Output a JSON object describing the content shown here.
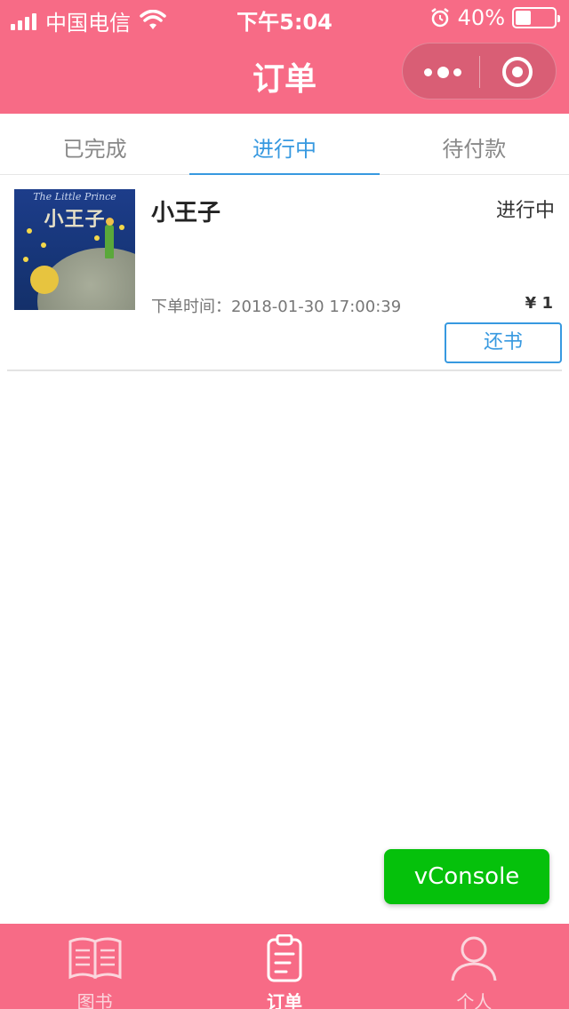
{
  "status_bar": {
    "carrier": "中国电信",
    "time": "下午5:04",
    "battery_percent": "40%",
    "battery_level": 0.4
  },
  "nav": {
    "title": "订单"
  },
  "tabs": [
    {
      "label": "已完成"
    },
    {
      "label": "进行中"
    },
    {
      "label": "待付款"
    }
  ],
  "active_tab": 1,
  "order": {
    "cover_en": "The Little Prince",
    "cover_cn": "小王子",
    "title": "小王子",
    "status": "进行中",
    "time_prefix": "下单时间：",
    "time": "2018-01-30 17:00:39",
    "price": "¥ 1",
    "return_label": "还书"
  },
  "vconsole": {
    "label": "vConsole"
  },
  "tabbar": [
    {
      "label": "图书",
      "icon": "book-icon"
    },
    {
      "label": "订单",
      "icon": "clipboard-icon"
    },
    {
      "label": "个人",
      "icon": "user-icon"
    }
  ],
  "colors": {
    "brand": "#f76b86",
    "accent": "#3799e0",
    "vconsole": "#05c10b"
  }
}
